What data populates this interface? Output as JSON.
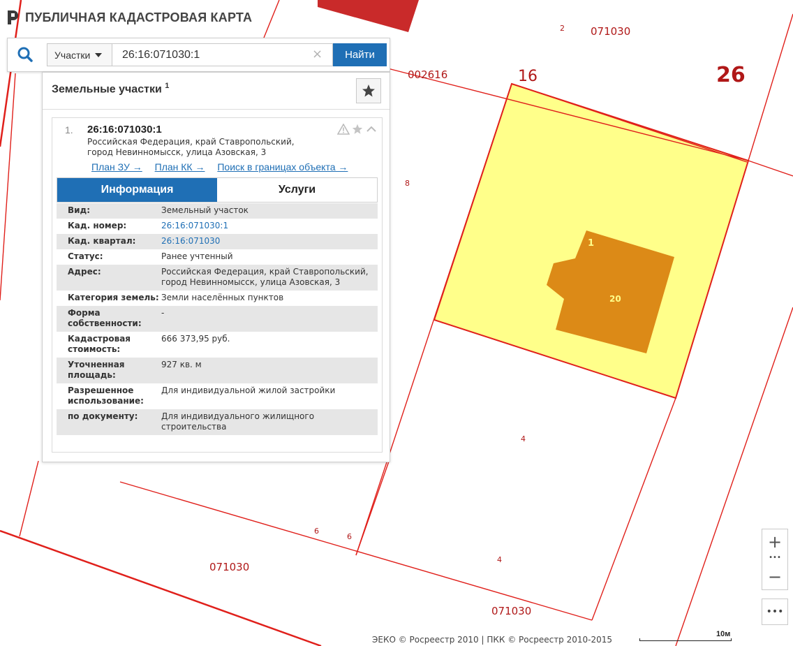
{
  "brand": {
    "title": "ПУБЛИЧНАЯ КАДАСТРОВАЯ КАРТА"
  },
  "search": {
    "type_label": "Участки",
    "value": "26:16:071030:1",
    "clear_glyph": "×",
    "submit_label": "Найти"
  },
  "results": {
    "title": "Земельные участки",
    "count": "1",
    "item": {
      "number": "1.",
      "cadastral": "26:16:071030:1",
      "address_line1": "Российская Федерация, край Ставропольский,",
      "address_line2": "город Невинномысск, улица Азовская, 3",
      "links": [
        "План ЗУ →",
        "План КК →",
        "Поиск в границах объекта →"
      ]
    },
    "tabs": [
      "Информация",
      "Услуги"
    ],
    "info": [
      {
        "key": "Вид:",
        "value": "Земельный участок"
      },
      {
        "key": "Кад. номер:",
        "value": "26:16:071030:1"
      },
      {
        "key": "Кад. квартал:",
        "value": "26:16:071030"
      },
      {
        "key": "Статус:",
        "value": "Ранее учтенный"
      },
      {
        "key": "Адрес:",
        "value": "Российская Федерация, край Ставропольский, город Невинномысск, улица Азовская, 3"
      },
      {
        "key": "Категория земель:",
        "value": "Земли населённых пунктов"
      },
      {
        "key": "Форма собственности:",
        "value": "-"
      },
      {
        "key": "Кадастровая стоимость:",
        "value": "666 373,95 руб."
      },
      {
        "key": "Уточненная площадь:",
        "value": "927 кв. м"
      },
      {
        "key": "Разрешенное использование:",
        "value": "Для индивидуальной жилой застройки"
      },
      {
        "key": "по документу:",
        "value": "Для индивидуального жилищного строительства"
      }
    ]
  },
  "map": {
    "labels": {
      "q_top": "071030",
      "q_left": "002616",
      "n16": "16",
      "n26": "26",
      "n2": "2",
      "n8": "8",
      "n4a": "4",
      "n4b": "4",
      "n6a": "6",
      "n6b": "6",
      "q_bottom_left": "071030",
      "q_bottom_right": "071030",
      "building_1": "1",
      "building_20": "20"
    },
    "colors": {
      "boundary": "#e0201b",
      "parcel_fill": "#ffff8a",
      "building_fill": "#dc8a17",
      "block_fill": "#c92a2a",
      "label": "#b01818"
    }
  },
  "controls": {
    "zoom_in": "+",
    "zoom_out": "−",
    "dots": "•••",
    "more": "•••"
  },
  "footer": {
    "attribution": "ЭЕКО © Росреестр 2010 | ПКК © Росреестр 2010-2015",
    "scale": "10м"
  }
}
